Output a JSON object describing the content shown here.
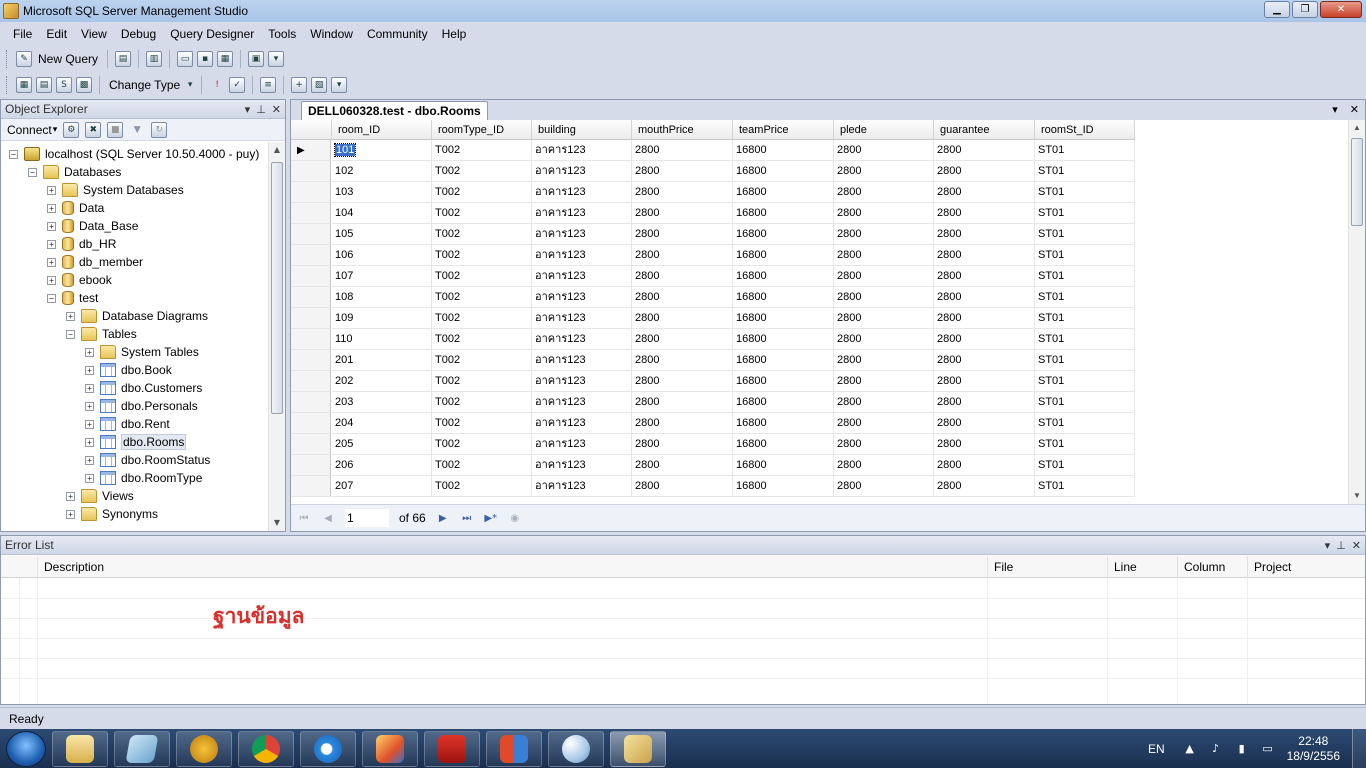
{
  "window": {
    "title": "Microsoft SQL Server Management Studio"
  },
  "menu": [
    "File",
    "Edit",
    "View",
    "Debug",
    "Query Designer",
    "Tools",
    "Window",
    "Community",
    "Help"
  ],
  "toolbar": {
    "new_query": "New Query",
    "change_type": "Change Type"
  },
  "object_explorer": {
    "title": "Object Explorer",
    "connect": "Connect",
    "tree": [
      {
        "label": "localhost (SQL Server 10.50.4000 - puy)",
        "level": 0,
        "icon": "server",
        "exp": "-"
      },
      {
        "label": "Databases",
        "level": 1,
        "icon": "folder",
        "exp": "-"
      },
      {
        "label": "System Databases",
        "level": 2,
        "icon": "folder",
        "exp": "+"
      },
      {
        "label": "Data",
        "level": 2,
        "icon": "db",
        "exp": "+"
      },
      {
        "label": "Data_Base",
        "level": 2,
        "icon": "db",
        "exp": "+"
      },
      {
        "label": "db_HR",
        "level": 2,
        "icon": "db",
        "exp": "+"
      },
      {
        "label": "db_member",
        "level": 2,
        "icon": "db",
        "exp": "+"
      },
      {
        "label": "ebook",
        "level": 2,
        "icon": "db",
        "exp": "+"
      },
      {
        "label": "test",
        "level": 2,
        "icon": "db",
        "exp": "-"
      },
      {
        "label": "Database Diagrams",
        "level": 3,
        "icon": "folder",
        "exp": "+"
      },
      {
        "label": "Tables",
        "level": 3,
        "icon": "folder",
        "exp": "-"
      },
      {
        "label": "System Tables",
        "level": 4,
        "icon": "folder",
        "exp": "+"
      },
      {
        "label": "dbo.Book",
        "level": 4,
        "icon": "table",
        "exp": "+"
      },
      {
        "label": "dbo.Customers",
        "level": 4,
        "icon": "table",
        "exp": "+"
      },
      {
        "label": "dbo.Personals",
        "level": 4,
        "icon": "table",
        "exp": "+"
      },
      {
        "label": "dbo.Rent",
        "level": 4,
        "icon": "table",
        "exp": "+"
      },
      {
        "label": "dbo.Rooms",
        "level": 4,
        "icon": "table",
        "exp": "+",
        "selected": true
      },
      {
        "label": "dbo.RoomStatus",
        "level": 4,
        "icon": "table",
        "exp": "+"
      },
      {
        "label": "dbo.RoomType",
        "level": 4,
        "icon": "table",
        "exp": "+"
      },
      {
        "label": "Views",
        "level": 3,
        "icon": "folder",
        "exp": "+"
      },
      {
        "label": "Synonyms",
        "level": 3,
        "icon": "folder",
        "exp": "+"
      }
    ]
  },
  "document": {
    "tab": "DELL060328.test - dbo.Rooms",
    "columns": [
      "room_ID",
      "roomType_ID",
      "building",
      "mouthPrice",
      "teamPrice",
      "plede",
      "guarantee",
      "roomSt_ID"
    ],
    "rows": [
      [
        "101",
        "T002",
        "อาคาร123",
        "2800",
        "16800",
        "2800",
        "2800",
        "ST01"
      ],
      [
        "102",
        "T002",
        "อาคาร123",
        "2800",
        "16800",
        "2800",
        "2800",
        "ST01"
      ],
      [
        "103",
        "T002",
        "อาคาร123",
        "2800",
        "16800",
        "2800",
        "2800",
        "ST01"
      ],
      [
        "104",
        "T002",
        "อาคาร123",
        "2800",
        "16800",
        "2800",
        "2800",
        "ST01"
      ],
      [
        "105",
        "T002",
        "อาคาร123",
        "2800",
        "16800",
        "2800",
        "2800",
        "ST01"
      ],
      [
        "106",
        "T002",
        "อาคาร123",
        "2800",
        "16800",
        "2800",
        "2800",
        "ST01"
      ],
      [
        "107",
        "T002",
        "อาคาร123",
        "2800",
        "16800",
        "2800",
        "2800",
        "ST01"
      ],
      [
        "108",
        "T002",
        "อาคาร123",
        "2800",
        "16800",
        "2800",
        "2800",
        "ST01"
      ],
      [
        "109",
        "T002",
        "อาคาร123",
        "2800",
        "16800",
        "2800",
        "2800",
        "ST01"
      ],
      [
        "110",
        "T002",
        "อาคาร123",
        "2800",
        "16800",
        "2800",
        "2800",
        "ST01"
      ],
      [
        "201",
        "T002",
        "อาคาร123",
        "2800",
        "16800",
        "2800",
        "2800",
        "ST01"
      ],
      [
        "202",
        "T002",
        "อาคาร123",
        "2800",
        "16800",
        "2800",
        "2800",
        "ST01"
      ],
      [
        "203",
        "T002",
        "อาคาร123",
        "2800",
        "16800",
        "2800",
        "2800",
        "ST01"
      ],
      [
        "204",
        "T002",
        "อาคาร123",
        "2800",
        "16800",
        "2800",
        "2800",
        "ST01"
      ],
      [
        "205",
        "T002",
        "อาคาร123",
        "2800",
        "16800",
        "2800",
        "2800",
        "ST01"
      ],
      [
        "206",
        "T002",
        "อาคาร123",
        "2800",
        "16800",
        "2800",
        "2800",
        "ST01"
      ],
      [
        "207",
        "T002",
        "อาคาร123",
        "2800",
        "16800",
        "2800",
        "2800",
        "ST01"
      ]
    ],
    "page_current": "1",
    "page_total": "of 66"
  },
  "error_list": {
    "title": "Error List",
    "columns": [
      "Description",
      "File",
      "Line",
      "Column",
      "Project"
    ],
    "overlay_text": "ฐานข้อมูล"
  },
  "status": {
    "text": "Ready"
  },
  "taskbar": {
    "lang": "EN",
    "time": "22:48",
    "date": "18/9/2556"
  },
  "colors": {
    "selection": "#3a6fc9",
    "overlay_text": "#d72f2a",
    "chrome": "#d6dbe9"
  }
}
